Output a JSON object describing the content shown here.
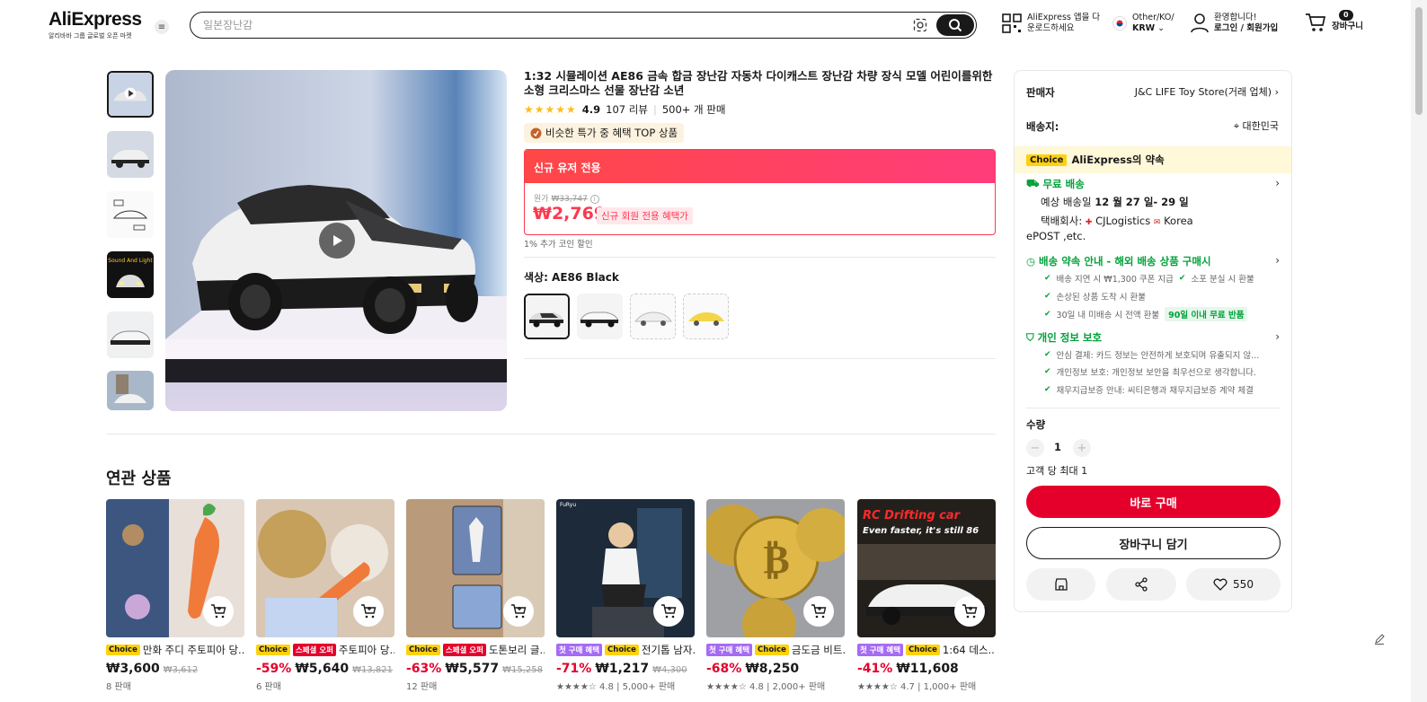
{
  "header": {
    "logo": "AliExpress",
    "logo_sub": "알리바바 그룹 글로벌 오픈 마켓",
    "search_placeholder": "일본장난감",
    "app_download_line1": "AliExpress 앱을 다",
    "app_download_line2": "운로드하세요",
    "locale_line1": "Other/KO/",
    "locale_line2": "KRW",
    "account_line1": "환영합니다!",
    "account_line2": "로그인 / 회원가입",
    "cart_count": "0",
    "cart_label": "장바구니"
  },
  "product": {
    "title": "1:32 시뮬레이션 AE86 금속 합금 장난감 자동차 다이캐스트 장난감 차량 장식 모델 어린이를위한 소형 크리스마스 선물 장난감 소년",
    "stars": "★★★★★",
    "rating": "4.9",
    "reviews": "107 리뷰",
    "sold": "500+ 개 판매",
    "top_badge": "비슷한 특가 중 혜택 TOP 상품",
    "price_header": "신규 유저 전용",
    "orig_label": "원가",
    "orig_price": "₩33,747",
    "price": "₩2,769",
    "new_member_tag": "신규 회원 전용 혜택가",
    "coin_note": "1% 추가 코인 할인",
    "color_label": "색상: AE86 Black"
  },
  "panel": {
    "seller_label": "판매자",
    "seller_name": "J&C LIFE Toy Store(거래 업체)",
    "ship_to_label": "배송지:",
    "ship_to": "대한민국",
    "choice_tag": "Choice",
    "choice_promise": "AliExpress의 약속",
    "free_shipping": "무료 배송",
    "delivery_est_prefix": "예상 배송일 ",
    "delivery_est": "12 월 27 일- 29 일",
    "carriers_label": "택배회사:",
    "carrier1": "CJLogistics",
    "carrier2": "Korea",
    "carrier2_tail": "ePOST ,etc.",
    "delivery_promise": "배송 약속 안내 - 해외 배송 상품 구매시",
    "promise_items": [
      "배송 지연 시 ₩1,300 쿠폰 지급",
      "소포 분실 시 환불",
      "손상된 상품 도착 시 환불",
      "30일 내 미배송 시 전액 환불"
    ],
    "promise_tag": "90일 이내 무료 반품",
    "privacy": "개인 정보 보호",
    "privacy_items": [
      "안심 결제: 카드 정보는 안전하게 보호되며 유출되지 않...",
      "개인정보 보호: 개인정보 보안을 최우선으로 생각합니다.",
      "채무지급보증 안내: 씨티은행과 채무지급보증 계약 체결"
    ],
    "qty_label": "수량",
    "qty": "1",
    "qty_limit": "고객 당 최대 1",
    "buy_now": "바로 구매",
    "add_cart": "장바구니 담기",
    "wishlist_count": "550"
  },
  "related": {
    "title": "연관 상품",
    "items": [
      {
        "tags": [
          "Choice"
        ],
        "name": "만화 주디 주토피아 당...",
        "disc": "",
        "price": "₩3,600",
        "orig": "₩3,612",
        "meta": "8 판매"
      },
      {
        "tags": [
          "Choice",
          "스페셜 오퍼"
        ],
        "name": "주토피아 당...",
        "disc": "-59%",
        "price": "₩5,640",
        "orig": "₩13,821",
        "meta": "6 판매"
      },
      {
        "tags": [
          "Choice",
          "스페셜 오퍼"
        ],
        "name": "도톤보리 글...",
        "disc": "-63%",
        "price": "₩5,577",
        "orig": "₩15,258",
        "meta": "12 판매"
      },
      {
        "tags": [
          "첫 구매 혜택",
          "Choice"
        ],
        "name": "전기톱 남자...",
        "disc": "-71%",
        "price": "₩1,217",
        "orig": "₩4,300",
        "meta": "★★★★☆ 4.8 | 5,000+ 판매"
      },
      {
        "tags": [
          "첫 구매 혜택",
          "Choice"
        ],
        "name": "금도금 비트...",
        "disc": "-68%",
        "price": "₩8,250",
        "orig": "",
        "meta": "★★★★☆ 4.8 | 2,000+ 판매"
      },
      {
        "tags": [
          "첫 구매 혜택",
          "Choice"
        ],
        "name": "1:64 데스...",
        "disc": "-41%",
        "price": "₩11,608",
        "orig": "",
        "meta": "★★★★☆ 4.7 | 1,000+ 판매"
      }
    ],
    "card6_overlay_line1": "RC Drifting car",
    "card6_overlay_line2": "Even faster, it's still 86",
    "card4_brand": "FuRyu"
  },
  "colors": {
    "accent": "#e4002b",
    "price_red": "#fd384f",
    "choice_yellow": "#fdd10f",
    "green": "#00a23a"
  }
}
